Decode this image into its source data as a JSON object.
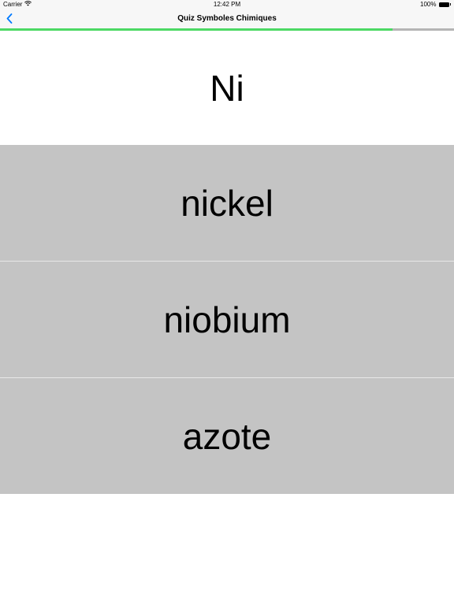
{
  "status_bar": {
    "carrier": "Carrier",
    "time": "12:42 PM",
    "battery_text": "100%",
    "battery_level": 1.0
  },
  "nav": {
    "title": "Quiz Symboles Chimiques",
    "back_icon": "chevron-left-icon",
    "accent_color": "#007aff"
  },
  "progress": {
    "fraction": 0.865,
    "fill_color": "#4cd964",
    "track_color": "#b5b5b5"
  },
  "question": {
    "symbol": "Ni"
  },
  "answers": [
    {
      "label": "nickel"
    },
    {
      "label": "niobium"
    },
    {
      "label": "azote"
    }
  ]
}
